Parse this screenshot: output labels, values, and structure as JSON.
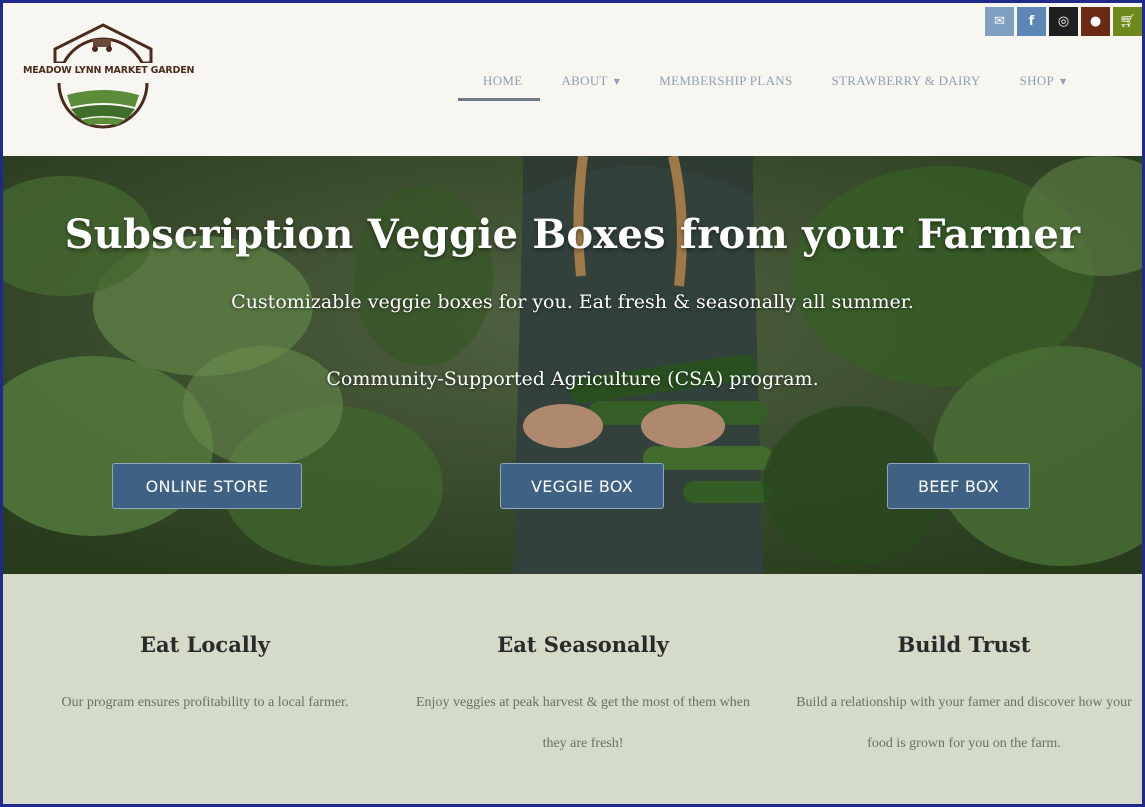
{
  "brand": {
    "name": "MEADOW LYNN MARKET GARDEN"
  },
  "social_icons": [
    {
      "icon": "email-icon",
      "color": "#7f9fc0"
    },
    {
      "icon": "facebook-icon",
      "color": "#5c86b5"
    },
    {
      "icon": "instagram-icon",
      "color": "#1f1f1f"
    },
    {
      "icon": "user-icon",
      "color": "#6b2a14"
    },
    {
      "icon": "cart-icon",
      "color": "#6f8a1c"
    }
  ],
  "nav": {
    "items": [
      {
        "label": "HOME",
        "active": true
      },
      {
        "label": "ABOUT",
        "dropdown": true
      },
      {
        "label": "MEMBERSHIP PLANS"
      },
      {
        "label": "STRAWBERRY & DAIRY"
      },
      {
        "label": "SHOP",
        "dropdown": true
      }
    ]
  },
  "hero": {
    "title": "Subscription Veggie Boxes from your Farmer",
    "subtitle": "Customizable veggie boxes for you. Eat fresh & seasonally all summer.",
    "tagline": "Community-Supported Agriculture (CSA) program.",
    "buttons": [
      "ONLINE STORE",
      "VEGGIE BOX",
      "BEEF BOX"
    ]
  },
  "features": [
    {
      "title": "Eat Locally",
      "text": "Our program ensures profitability to a local farmer."
    },
    {
      "title": "Eat Seasonally",
      "text": "Enjoy veggies at peak harvest & get the most of them when they are fresh!"
    },
    {
      "title": "Build Trust",
      "text": "Build a relationship with your famer and discover how your food is grown for you on the farm."
    }
  ],
  "colors": {
    "button": "#3f6284",
    "features_bg": "#d4dbc8",
    "header_bg": "#f8f6f1",
    "frame_border": "#1f2a8a"
  }
}
